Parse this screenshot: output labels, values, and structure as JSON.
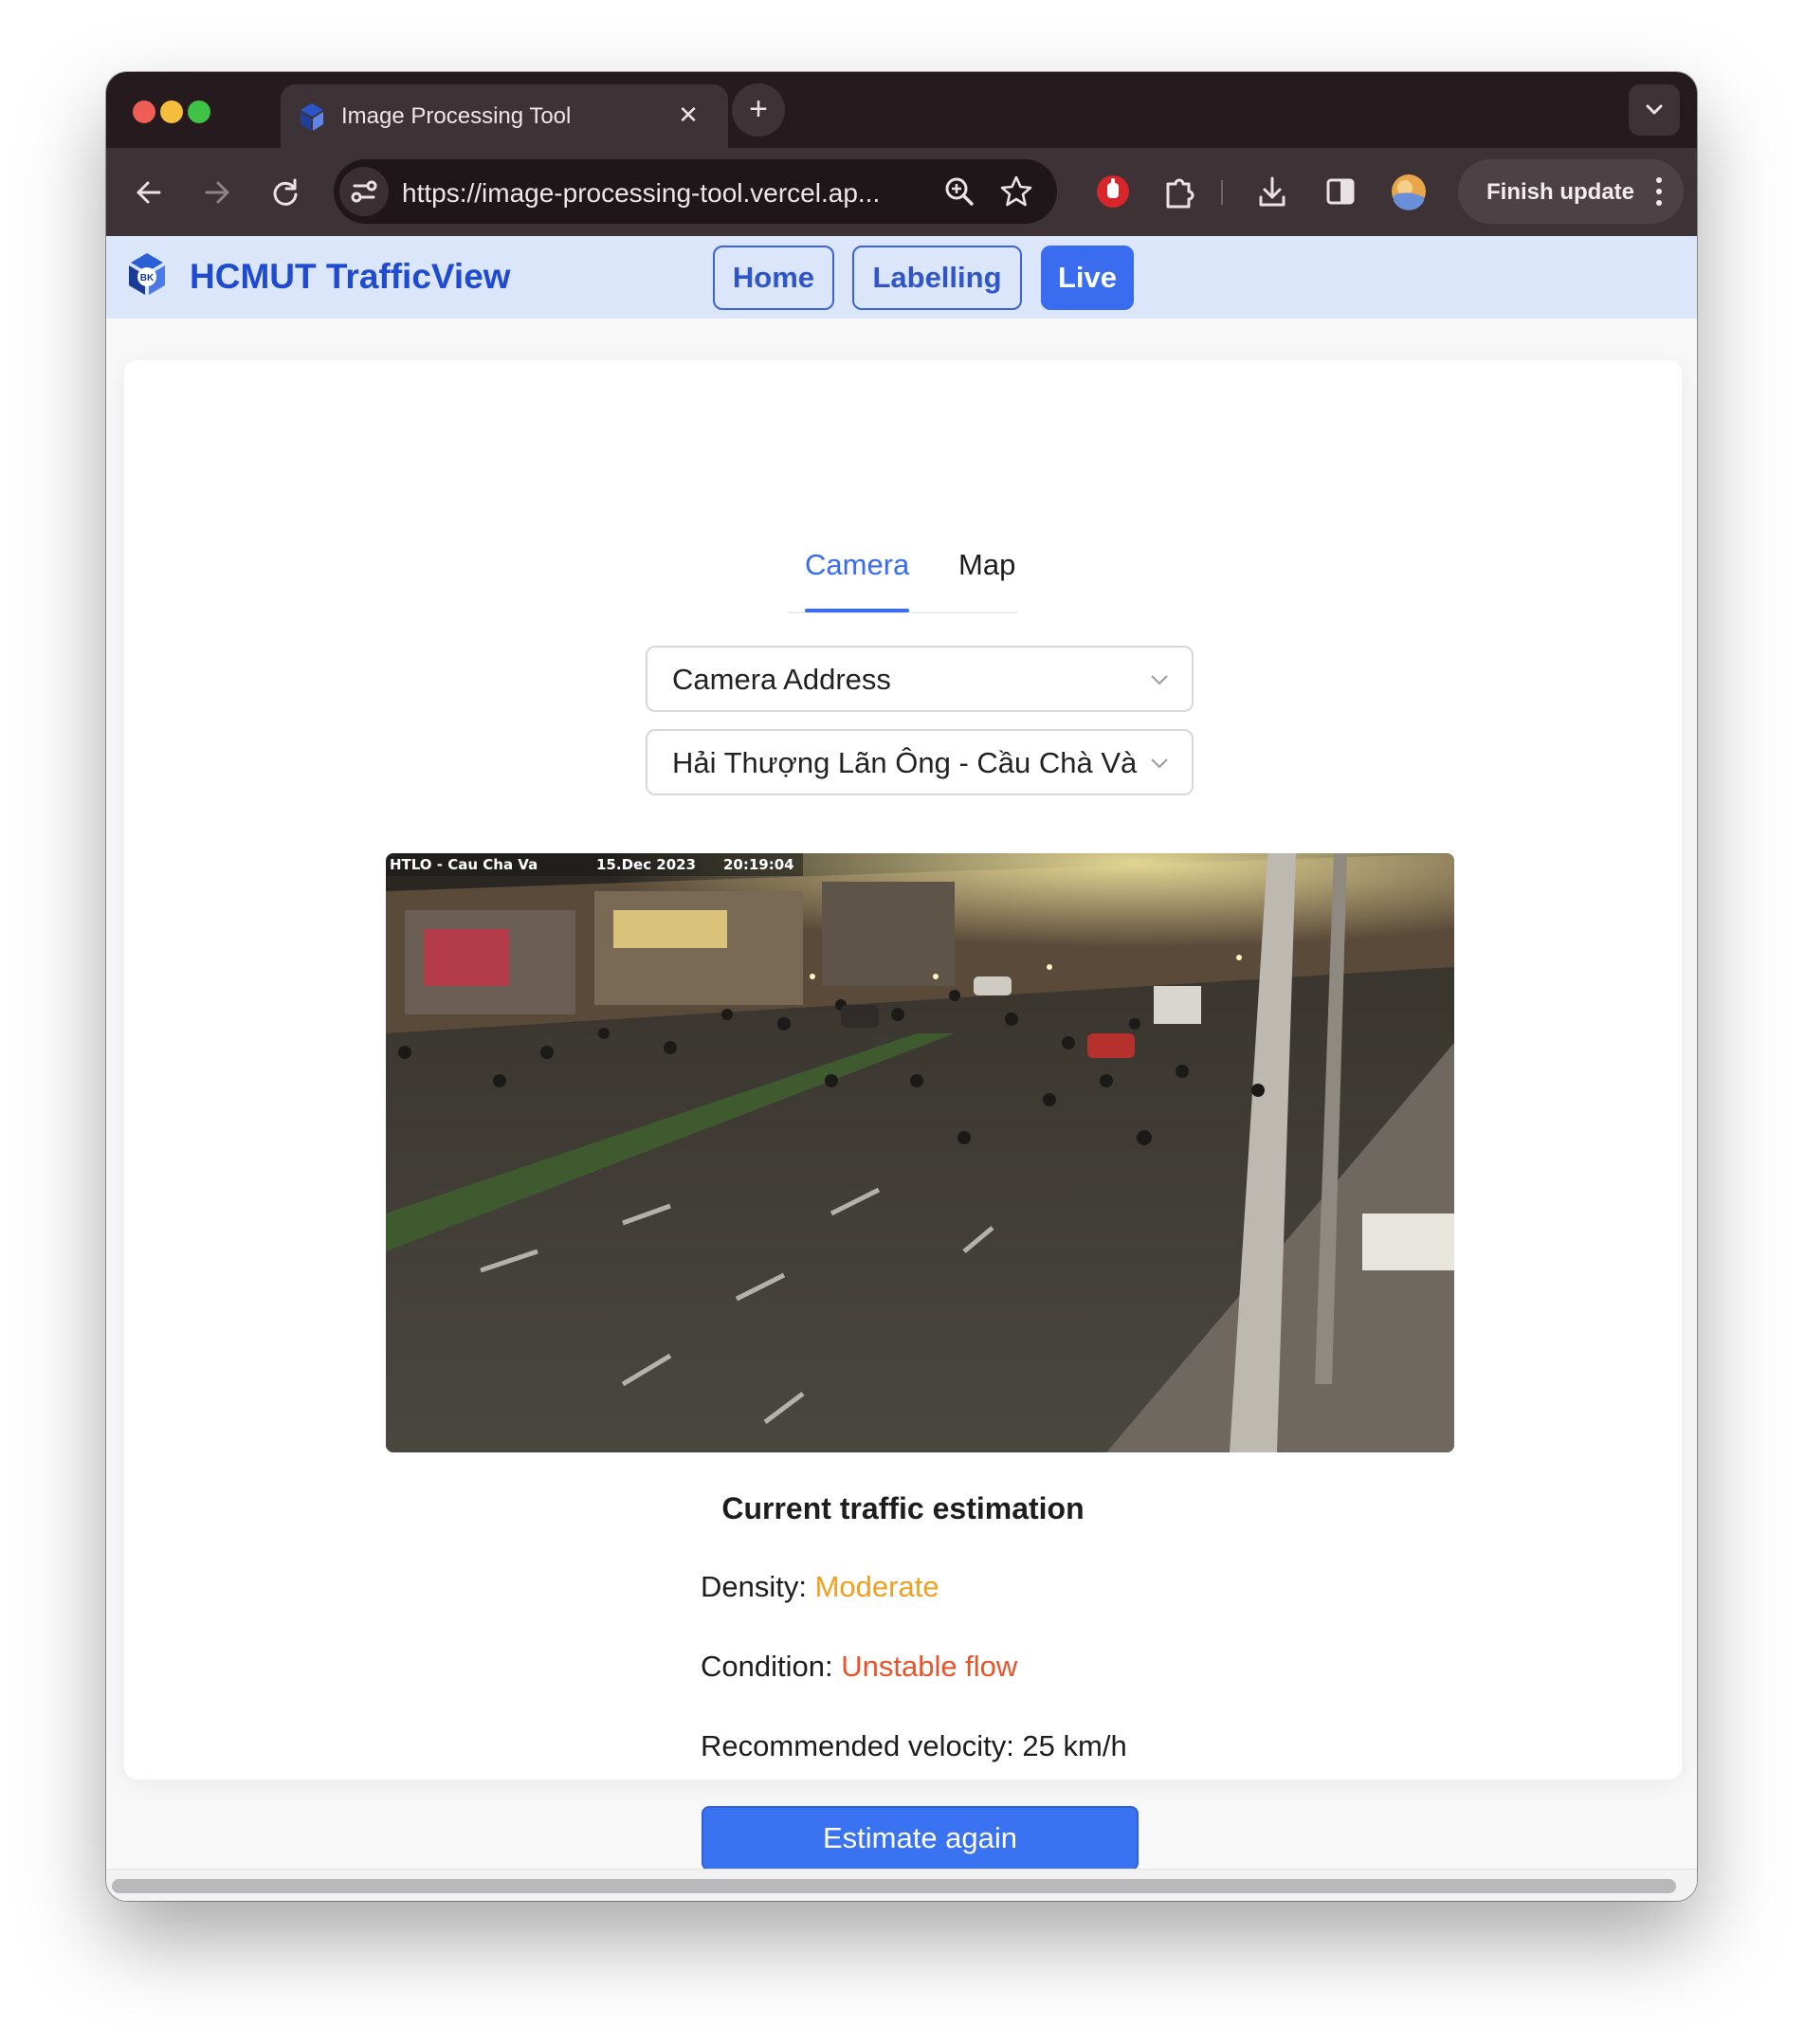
{
  "browser": {
    "tab_title": "Image Processing Tool",
    "tab_close_glyph": "✕",
    "new_tab_glyph": "+",
    "url": "https://image-processing-tool.vercel.ap...",
    "update_label": "Finish update",
    "icons": [
      "back-icon",
      "forward-icon",
      "reload-icon",
      "site-settings-icon",
      "zoom-icon",
      "bookmark-star-icon",
      "extension-blocker-icon",
      "extensions-puzzle-icon",
      "download-icon",
      "side-panel-icon",
      "profile-avatar-icon",
      "more-vert-icon"
    ]
  },
  "app": {
    "brand": "HCMUT TrafficView",
    "nav": [
      {
        "label": "Home",
        "active": false
      },
      {
        "label": "Labelling",
        "active": false
      },
      {
        "label": "Live",
        "active": true
      }
    ]
  },
  "main": {
    "tabs": [
      {
        "label": "Camera",
        "active": true
      },
      {
        "label": "Map",
        "active": false
      }
    ],
    "address_select": "Camera Address",
    "camera_select": "Hải Thượng Lãn Ông - Cầu Chà Và",
    "camera_feed": {
      "overlay_location": "HTLO - Cau Cha Va",
      "overlay_date": "15.Dec 2023",
      "overlay_time": "20:19:04"
    },
    "result": {
      "title": "Current traffic estimation",
      "density_label": "Density:",
      "density_value": "Moderate",
      "condition_label": "Condition:",
      "condition_value": "Unstable flow",
      "velocity_text": "Recommended velocity: 25 km/h"
    },
    "estimate_button": "Estimate again"
  },
  "colors": {
    "accent": "#3a6cf0",
    "brand": "#1f4bd0",
    "moderate": "#f0a020",
    "unstable": "#e8542a"
  }
}
